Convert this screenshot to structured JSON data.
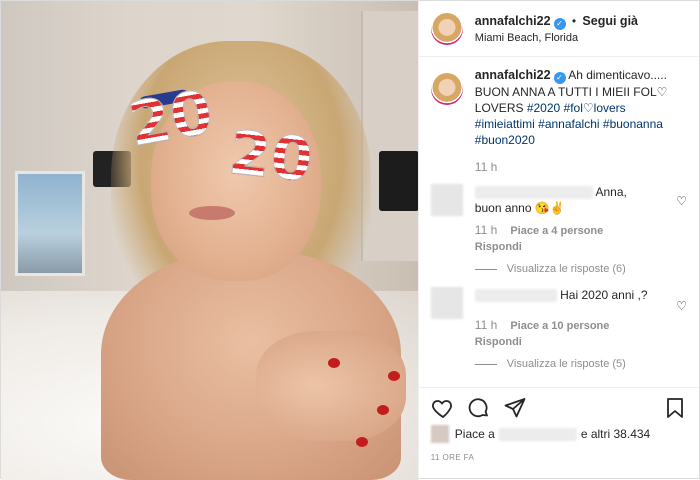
{
  "post": {
    "username": "annafalchi22",
    "follow_label": "Segui già",
    "location": "Miami Beach, Florida",
    "photo_text": {
      "glasses_left": "20",
      "glasses_right": "20"
    }
  },
  "caption": {
    "username": "annafalchi22",
    "text_1": "Ah dimenticavo.....",
    "text_2": "BUON ANNA A TUTTI I MIEII FOL",
    "text_3": "LOVERS ",
    "tag_1": "#2020",
    "tag_2": "#fol",
    "tag_2b": "lovers",
    "tag_3": "#imieiattimi",
    "tag_4": "#annafalchi",
    "tag_5": "#buonanna",
    "tag_6": "#buon2020",
    "time": "11 h"
  },
  "comments": [
    {
      "text_1": "Anna,",
      "text_2": "buon anno ",
      "emoji": "😘✌",
      "time": "11 h",
      "likes": "Piace a 4 persone",
      "reply": "Rispondi",
      "view_replies": "Visualizza le risposte (6)"
    },
    {
      "text": "Hai 2020 anni ,?",
      "time": "11 h",
      "likes": "Piace a 10 persone",
      "reply": "Rispondi",
      "view_replies": "Visualizza le risposte (5)"
    }
  ],
  "likes": {
    "prefix": "Piace a",
    "suffix": "e altri 38.434"
  },
  "date": "11 ORE FA",
  "icons": [
    "heart-icon",
    "comment-icon",
    "share-icon",
    "bookmark-icon",
    "verified-icon"
  ],
  "colors": {
    "hashtag": "#003569",
    "verified": "#3897f0",
    "muted": "#8e8e8e",
    "text": "#262626"
  }
}
